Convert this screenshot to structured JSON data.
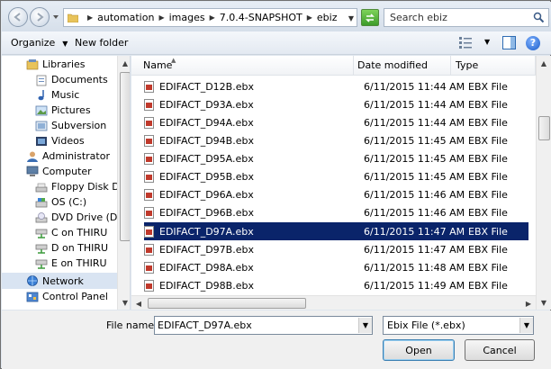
{
  "address": {
    "crumbs": [
      "automation",
      "images",
      "7.0.4-SNAPSHOT",
      "ebiz"
    ]
  },
  "search": {
    "placeholder": "Search ebiz"
  },
  "toolbar": {
    "organize_label": "Organize",
    "new_folder_label": "New folder"
  },
  "nav": {
    "items": [
      {
        "label": "Libraries",
        "icon": "libraries-icon"
      },
      {
        "label": "Documents",
        "icon": "documents-icon"
      },
      {
        "label": "Music",
        "icon": "music-icon"
      },
      {
        "label": "Pictures",
        "icon": "pictures-icon"
      },
      {
        "label": "Subversion",
        "icon": "subversion-icon"
      },
      {
        "label": "Videos",
        "icon": "videos-icon"
      },
      {
        "label": "Administrator",
        "icon": "user-icon"
      },
      {
        "label": "Computer",
        "icon": "computer-icon"
      },
      {
        "label": "Floppy Disk Drive",
        "icon": "floppy-icon"
      },
      {
        "label": "OS (C:)",
        "icon": "drive-icon"
      },
      {
        "label": "DVD Drive (D:)",
        "icon": "dvd-icon"
      },
      {
        "label": "C on THIRU",
        "icon": "network-drive-icon"
      },
      {
        "label": "D on THIRU",
        "icon": "network-drive-icon"
      },
      {
        "label": "E on THIRU",
        "icon": "network-drive-icon"
      },
      {
        "label": "Network",
        "icon": "network-icon"
      },
      {
        "label": "Control Panel",
        "icon": "control-panel-icon"
      }
    ]
  },
  "columns": {
    "name": "Name",
    "date": "Date modified",
    "type": "Type"
  },
  "files": [
    {
      "name": "EDIFACT_D12B.ebx",
      "date": "6/11/2015 11:44 AM",
      "type": "EBX File"
    },
    {
      "name": "EDIFACT_D93A.ebx",
      "date": "6/11/2015 11:44 AM",
      "type": "EBX File"
    },
    {
      "name": "EDIFACT_D94A.ebx",
      "date": "6/11/2015 11:44 AM",
      "type": "EBX File"
    },
    {
      "name": "EDIFACT_D94B.ebx",
      "date": "6/11/2015 11:45 AM",
      "type": "EBX File"
    },
    {
      "name": "EDIFACT_D95A.ebx",
      "date": "6/11/2015 11:45 AM",
      "type": "EBX File"
    },
    {
      "name": "EDIFACT_D95B.ebx",
      "date": "6/11/2015 11:45 AM",
      "type": "EBX File"
    },
    {
      "name": "EDIFACT_D96A.ebx",
      "date": "6/11/2015 11:46 AM",
      "type": "EBX File"
    },
    {
      "name": "EDIFACT_D96B.ebx",
      "date": "6/11/2015 11:46 AM",
      "type": "EBX File"
    },
    {
      "name": "EDIFACT_D97A.ebx",
      "date": "6/11/2015 11:47 AM",
      "type": "EBX File"
    },
    {
      "name": "EDIFACT_D97B.ebx",
      "date": "6/11/2015 11:47 AM",
      "type": "EBX File"
    },
    {
      "name": "EDIFACT_D98A.ebx",
      "date": "6/11/2015 11:48 AM",
      "type": "EBX File"
    },
    {
      "name": "EDIFACT_D98B.ebx",
      "date": "6/11/2015 11:49 AM",
      "type": "EBX File"
    }
  ],
  "selected_file_index": 8,
  "footer": {
    "file_name_label": "File name:",
    "file_name_value": "EDIFACT_D97A.ebx",
    "file_type_value": "Ebix File (*.ebx)",
    "open_label": "Open",
    "cancel_label": "Cancel"
  },
  "colors": {
    "selection": "#0a246a",
    "nav_selection": "#d9e4f2"
  }
}
